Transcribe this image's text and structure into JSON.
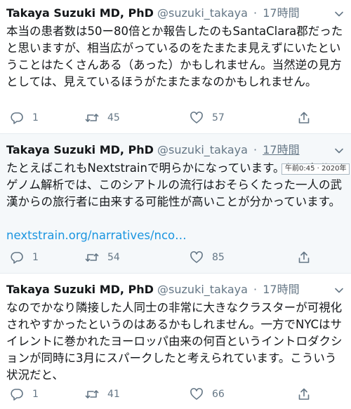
{
  "tweets": [
    {
      "author_name": "Takaya Suzuki MD, PhD",
      "handle": "@suzuki_takaya",
      "separator": "·",
      "time": "17時間",
      "text": "本当の患者数は50ー80倍とか報告したのもSantaClara郡だったと思いますが、相当広がっているのをたまたま見えずにいたということはたくさんある（あった）かもしれません。当然逆の見方としては、見えているほうがたまたまなのかもしれません。",
      "link": "",
      "replies": "1",
      "retweets": "45",
      "likes": "57"
    },
    {
      "author_name": "Takaya Suzuki MD, PhD",
      "handle": "@suzuki_takaya",
      "separator": "·",
      "time": "17時間",
      "text": "たとえばこれもNextstrainで明らかになっています。シアトルのゲノム解析では、このシアトルの流行はおそらくたった一人の武漢からの旅行者に由来する可能性が高いことが分かっています。",
      "link": "nextstrain.org/narratives/nco…",
      "replies": "1",
      "retweets": "54",
      "likes": "85"
    },
    {
      "author_name": "Takaya Suzuki MD, PhD",
      "handle": "@suzuki_takaya",
      "separator": "·",
      "time": "17時間",
      "text": "なのでかなり隣接した人同士の非常に大きなクラスターが可視化されやすかったというのはあるかもしれません。一方でNYCはサイレントに巻かれたヨーロッパ由来の何百というイントロダクションが同時に3月にスパークしたと考えられています。こういう状況だと、",
      "link": "",
      "replies": "1",
      "retweets": "41",
      "likes": "66"
    }
  ],
  "tooltip": "午前0:45 · 2020年",
  "icons": {
    "reply": "reply-icon",
    "retweet": "retweet-icon",
    "like": "heart-icon",
    "share": "share-icon",
    "more": "chevron-down-icon"
  },
  "colors": {
    "text": "#14171a",
    "muted": "#657786",
    "link": "#1b95e0",
    "highlight_bg": "#f5f8fa"
  }
}
